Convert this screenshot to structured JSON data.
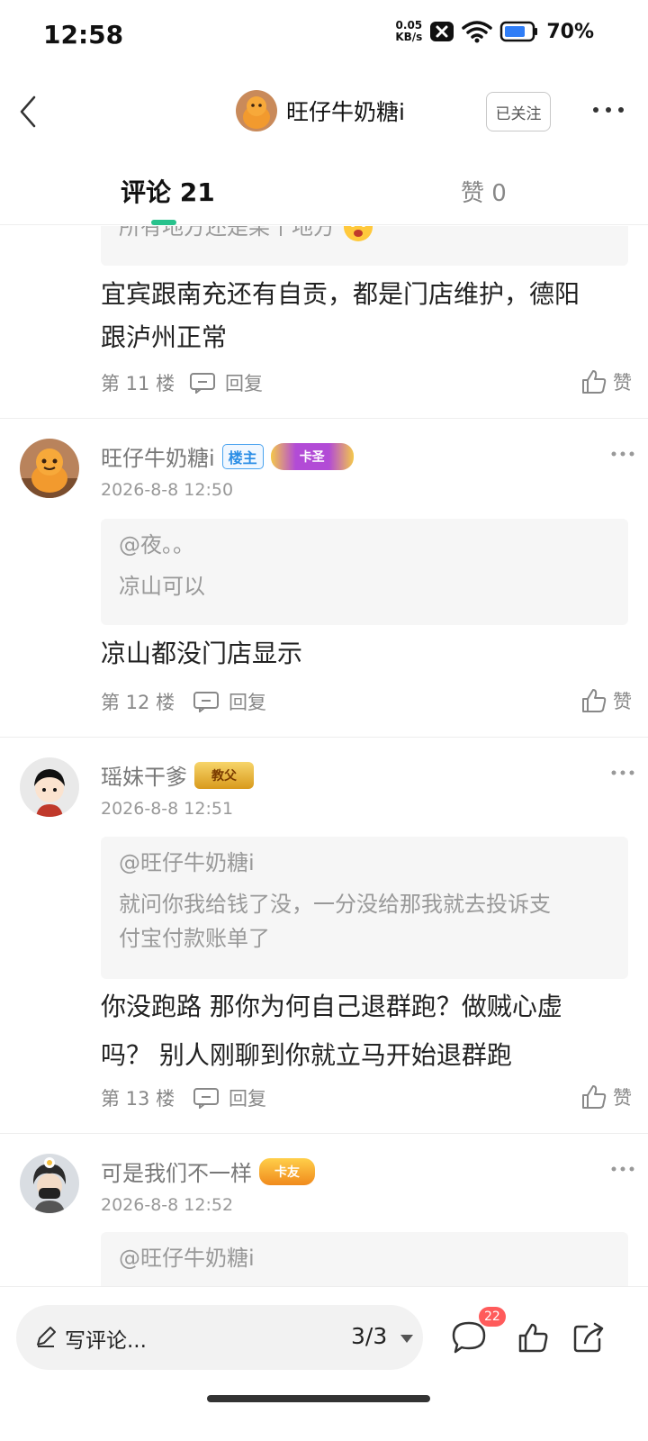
{
  "status_bar": {
    "time": "12:58",
    "net_speed_value": "0.05",
    "net_speed_unit": "KB/s",
    "battery": "70%",
    "icons": [
      "notification-x-icon",
      "wifi-icon",
      "battery-icon"
    ]
  },
  "header": {
    "user_name": "旺仔牛奶糖i",
    "follow_label": "已关注",
    "icons": [
      "back-icon",
      "more-icon"
    ]
  },
  "tabs": {
    "comments_label": "评论 21",
    "likes_label": "赞 0"
  },
  "feed": {
    "partial_top": {
      "quote_text": "所有地方还是某个地方",
      "text_line1": "宜宾跟南充还有自贡，都是门店维护，德阳",
      "text_line2": "跟泸州正常",
      "floor": "第 11 楼",
      "reply_label": "回复",
      "like_label": "赞"
    },
    "comments": [
      {
        "author": "旺仔牛奶糖i",
        "owner_badge": "楼主",
        "rank_badge": "卡圣",
        "time": "2026-8-8 12:50",
        "quote_user": "@夜。。",
        "quote_line1": "凉山可以",
        "text_line1": "凉山都没门店显示",
        "floor": "第 12 楼",
        "reply_label": "回复",
        "like_label": "赞"
      },
      {
        "author": "瑶妹干爹",
        "rank_badge": "教父",
        "time": "2026-8-8 12:51",
        "quote_user": "@旺仔牛奶糖i",
        "quote_line1": "就问你我给钱了没，一分没给那我就去投诉支",
        "quote_line2": "付宝付款账单了",
        "text_line1": "你没跑路 那你为何自己退群跑？做贼心虚",
        "text_line2": "吗？ 别人刚聊到你就立马开始退群跑",
        "floor": "第 13 楼",
        "reply_label": "回复",
        "like_label": "赞"
      },
      {
        "author": "可是我们不一样",
        "rank_badge": "卡友",
        "time": "2026-8-8 12:52",
        "quote_user": "@旺仔牛奶糖i"
      }
    ]
  },
  "bottom_bar": {
    "write_placeholder": "写评论...",
    "page": "3/3",
    "comment_count": "22",
    "icons": [
      "pencil-icon",
      "caret-down-icon",
      "comment-icon",
      "thumb-up-icon",
      "share-icon"
    ]
  },
  "colors": {
    "accent_green": "#27c28c",
    "badge_blue": "#2b8ee6",
    "badge_red": "#ff5b5b",
    "gold": "#e6a817"
  }
}
